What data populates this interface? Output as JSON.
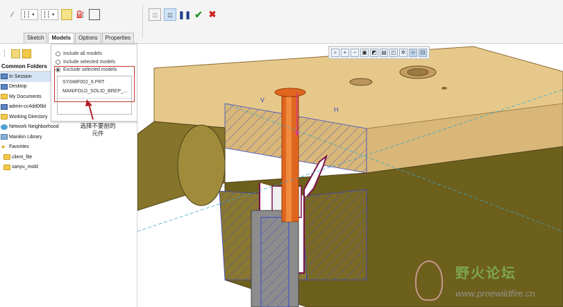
{
  "ribbon": {
    "tabs": [
      {
        "label": "Sketch",
        "active": false
      },
      {
        "label": "Models",
        "active": true
      },
      {
        "label": "Options",
        "active": false
      },
      {
        "label": "Properties",
        "active": false
      }
    ],
    "toolbar_icons": [
      "slope-icon",
      "pattern-left-dropdown",
      "pattern-right-dropdown",
      "note-icon",
      "paint-bucket-icon",
      "frame-icon"
    ],
    "pattern_left": "┆┆",
    "pattern_right": "┆┆",
    "actions": [
      "preview-off-icon",
      "preview-on-icon",
      "pause-icon",
      "ok-check-icon",
      "cancel-x-icon"
    ]
  },
  "left_panel": {
    "header": "Common Folders",
    "items": [
      {
        "label": "In Session",
        "icon": "monitor-icon",
        "selected": true
      },
      {
        "label": "Desktop",
        "icon": "folder-icon"
      },
      {
        "label": "My Documents",
        "icon": "folder-icon"
      },
      {
        "label": "admin-cc4dd06bl",
        "icon": "monitor-icon"
      },
      {
        "label": "Working Directory",
        "icon": "folder-icon"
      },
      {
        "label": "Network Neighborhood",
        "icon": "network-icon"
      },
      {
        "label": "Manikin Library",
        "icon": "manikin-icon"
      },
      {
        "label": "Favorites",
        "icon": "star-icon"
      },
      {
        "label": "client_file",
        "icon": "folder-icon"
      },
      {
        "label": "sanyu_mold",
        "icon": "folder-icon"
      }
    ]
  },
  "models_popup": {
    "options": [
      {
        "label": "Include all models",
        "selected": false
      },
      {
        "label": "Include selected models",
        "selected": false
      },
      {
        "label": "Exclude selected models",
        "selected": true
      }
    ],
    "selected_models": [
      "SY048F002_6.PRT",
      "MANIFOLD_SOLID_BREP_..."
    ]
  },
  "annotation": {
    "line1": "选择不要剖的",
    "line2": "元件"
  },
  "viewport": {
    "label_h": "H",
    "label_v": "V",
    "toolbar_icons": [
      "refit-icon",
      "zoom-in-icon",
      "zoom-out-icon",
      "repaint-icon",
      "orient-icon",
      "saved-views-icon",
      "display-style-icon",
      "datum-display-icon",
      "spin-center-icon",
      "annotation-display-icon"
    ]
  },
  "watermark": {
    "title": "野火论坛",
    "url": "www.proewildfire.cn"
  },
  "colors": {
    "accent_red": "#c0392b",
    "part_tan": "#e6c98a",
    "part_olive": "#6d5f1c",
    "insert_orange": "#e0661f",
    "selection_blue": "#d5e4f5"
  }
}
